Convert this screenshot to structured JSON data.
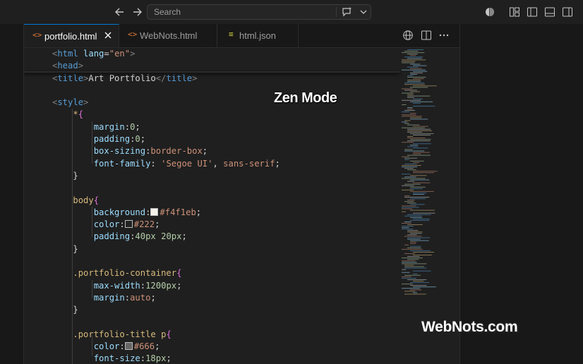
{
  "titlebar": {
    "search_placeholder": "Search",
    "icons": [
      "arrow-left-icon",
      "arrow-right-icon",
      "chat-sparkle-icon",
      "chevron-down-icon",
      "accounts-icon",
      "customize-layout-icon",
      "toggle-primary-sidebar-icon",
      "toggle-panel-icon",
      "toggle-secondary-sidebar-icon"
    ]
  },
  "tabs": [
    {
      "label": "portfolio.html",
      "icon_glyph": "<>",
      "active": true
    },
    {
      "label": "WebNots.html",
      "icon_glyph": "<>",
      "active": false
    },
    {
      "label": "html.json",
      "icon_glyph": "≡",
      "active": false
    }
  ],
  "tab_actions": [
    "preview-globe-icon",
    "split-editor-icon",
    "more-actions-icon"
  ],
  "colors": {
    "accent": "#0078d4",
    "swatch_f4f1eb": "#f4f1eb",
    "swatch_222": "#222222",
    "swatch_666": "#666666"
  },
  "code": {
    "l1_open": "<",
    "l1_tag": "html",
    "l1_attr": "lang",
    "l1_eq": "=",
    "l1_val": "\"en\"",
    "l1_close": ">",
    "l2_open": "<",
    "l2_tag": "head",
    "l2_close": ">",
    "l3_open": "<",
    "l3_tag": "title",
    "l3_close": ">",
    "l3_text": "Art Portfolio",
    "l3_open2": "</",
    "l3_tag2": "title",
    "l3_close2": ">",
    "l5_open": "<",
    "l5_tag": "style",
    "l5_close": ">",
    "l6_sel": "*",
    "l6_brace": "{",
    "l7_prop": "margin",
    "l7_val": "0",
    "l7_end": ";",
    "l8_prop": "padding",
    "l8_val": "0",
    "l8_end": ";",
    "l9_prop": "box-sizing",
    "l9_val": "border-box",
    "l9_end": ";",
    "l10_prop": "font-family",
    "l10_val1": "'Segoe UI'",
    "l10_sep": ", ",
    "l10_val2": "sans-serif",
    "l10_end": ";",
    "l11_brace": "}",
    "l13_sel": "body",
    "l13_brace": "{",
    "l14_prop": "background",
    "l14_val": "#f4f1eb",
    "l14_end": ";",
    "l15_prop": "color",
    "l15_val": "#222",
    "l15_end": ";",
    "l16_prop": "padding",
    "l16_val": "40px 20px",
    "l16_end": ";",
    "l17_brace": "}",
    "l19_sel": ".portfolio-container",
    "l19_brace": "{",
    "l20_prop": "max-width",
    "l20_val": "1200px",
    "l20_end": ";",
    "l21_prop": "margin",
    "l21_val": "auto",
    "l21_end": ";",
    "l22_brace": "}",
    "l24_sel": ".portfolio-title p",
    "l24_brace": "{",
    "l25_prop": "color",
    "l25_val": "#666",
    "l25_end": ";",
    "l26_prop": "font-size",
    "l26_val": "18px",
    "l26_end": ";",
    "l27_brace": "}",
    "colon": ":"
  },
  "overlays": {
    "zen_label": "Zen Mode",
    "brand": "WebNots.com"
  }
}
